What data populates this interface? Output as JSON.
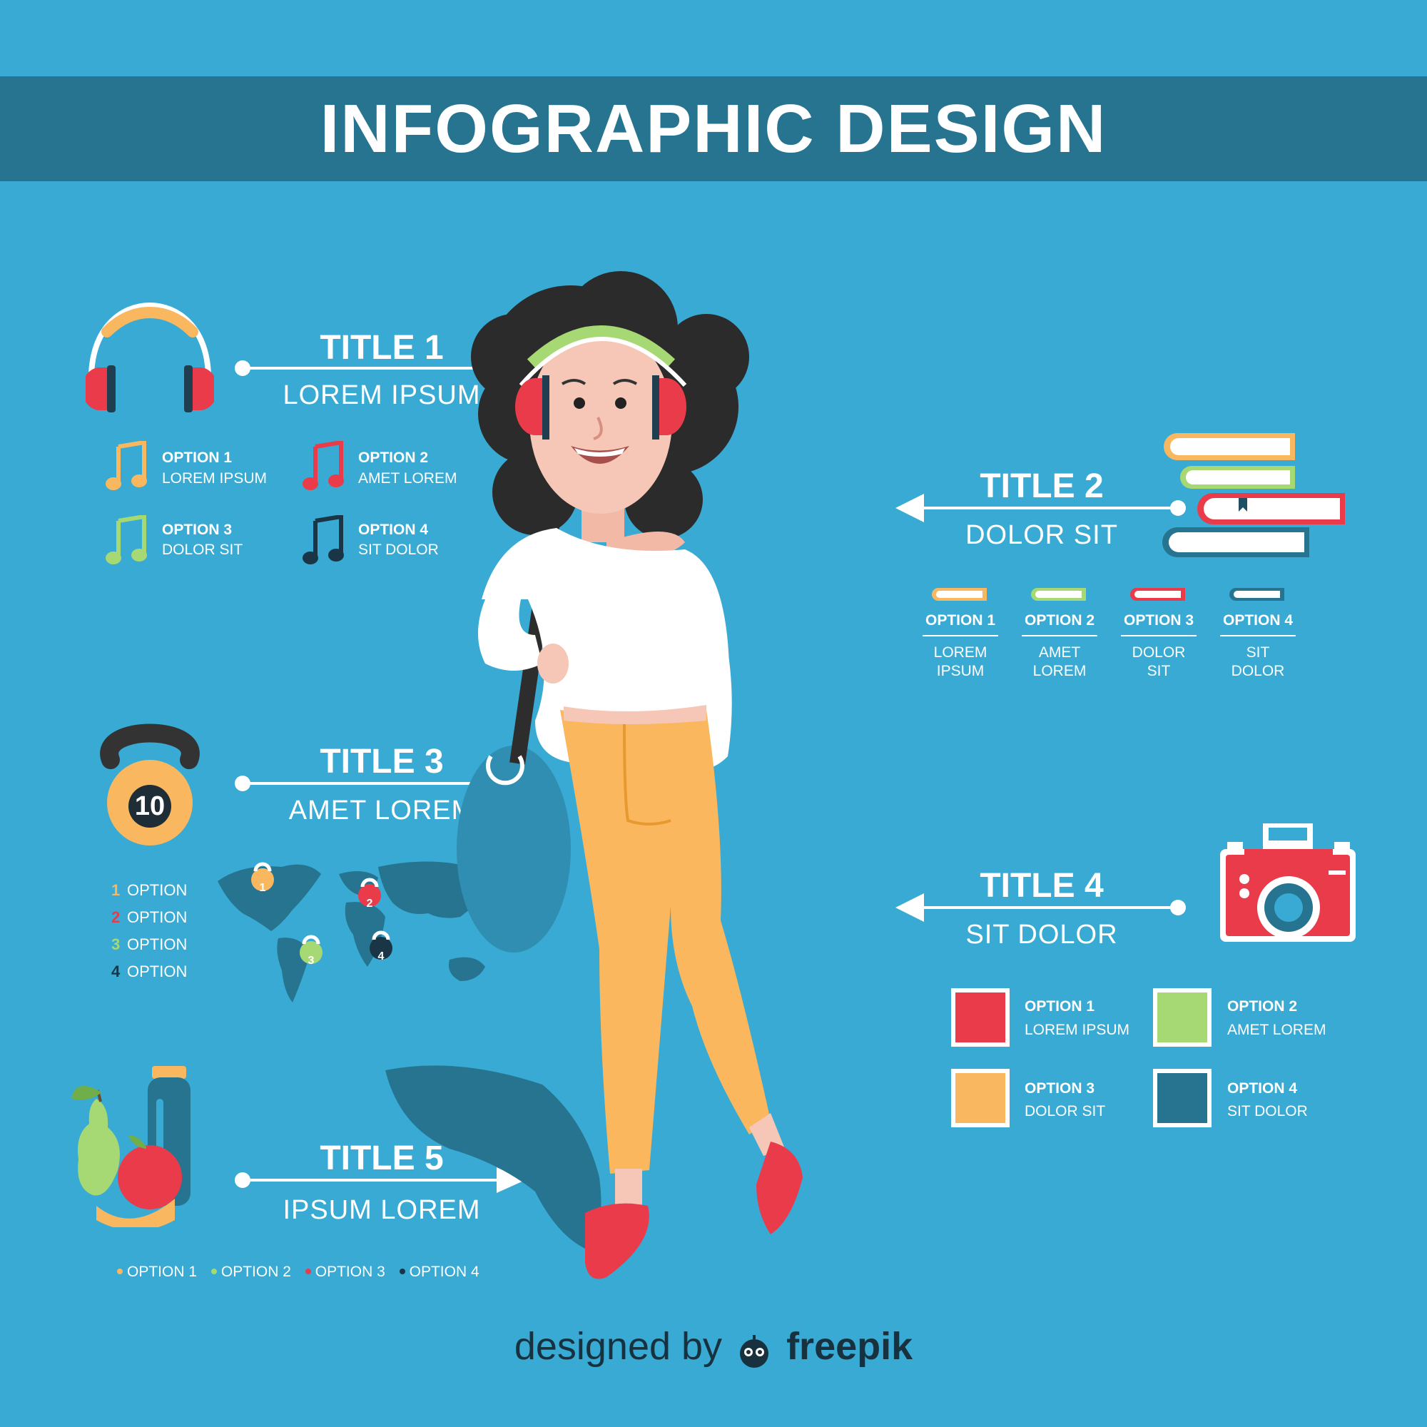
{
  "header": {
    "title": "INFOGRAPHIC DESIGN"
  },
  "colors": {
    "background": "#38aad3",
    "banner": "#267490",
    "orange": "#f9b860",
    "green": "#a6d873",
    "red": "#ea3b4b",
    "navy": "#1f4f66"
  },
  "sections": {
    "s1": {
      "title": "TITLE 1",
      "subtitle": "LOREM IPSUM",
      "icon": "headphones-icon",
      "options": [
        {
          "head": "OPTION 1",
          "body": "LOREM IPSUM",
          "icon": "music-note-icon"
        },
        {
          "head": "OPTION 2",
          "body": "AMET LOREM",
          "icon": "music-note-icon"
        },
        {
          "head": "OPTION 3",
          "body": "DOLOR SIT",
          "icon": "music-note-icon"
        },
        {
          "head": "OPTION 4",
          "body": "SIT DOLOR",
          "icon": "music-note-icon"
        }
      ]
    },
    "s2": {
      "title": "TITLE 2",
      "subtitle": "DOLOR SIT",
      "icon": "book-stack-icon",
      "options": [
        {
          "head": "OPTION 1",
          "body": "LOREM IPSUM"
        },
        {
          "head": "OPTION 2",
          "body": "AMET LOREM"
        },
        {
          "head": "OPTION 3",
          "body": "DOLOR SIT"
        },
        {
          "head": "OPTION 4",
          "body": "SIT DOLOR"
        }
      ]
    },
    "s3": {
      "title": "TITLE 3",
      "subtitle": "AMET LOREM",
      "icon": "kettlebell-icon",
      "kettlebell_number": "10",
      "options": [
        {
          "num": "1",
          "label": "OPTION"
        },
        {
          "num": "2",
          "label": "OPTION"
        },
        {
          "num": "3",
          "label": "OPTION"
        },
        {
          "num": "4",
          "label": "OPTION"
        }
      ],
      "map_markers": [
        "1",
        "2",
        "3",
        "4"
      ]
    },
    "s4": {
      "title": "TITLE 4",
      "subtitle": "SIT DOLOR",
      "icon": "camera-icon",
      "options": [
        {
          "head": "OPTION 1",
          "body": "LOREM IPSUM"
        },
        {
          "head": "OPTION 2",
          "body": "AMET LOREM"
        },
        {
          "head": "OPTION 3",
          "body": "DOLOR SIT"
        },
        {
          "head": "OPTION 4",
          "body": "SIT DOLOR"
        }
      ]
    },
    "s5": {
      "title": "TITLE 5",
      "subtitle": "IPSUM LOREM",
      "icon": "fruit-bottle-icon",
      "legend": [
        "OPTION 1",
        "OPTION 2",
        "OPTION 3",
        "OPTION 4"
      ]
    }
  },
  "footer": {
    "prefix": "designed by",
    "brand": "freepik"
  }
}
